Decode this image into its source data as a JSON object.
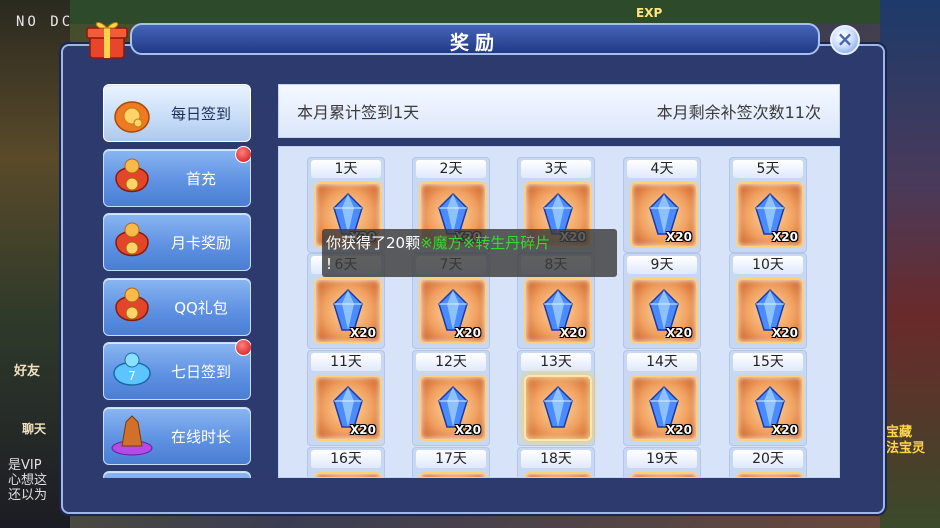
{
  "hud": {
    "top_left_text": "NO DC",
    "exp_label": "EXP",
    "side_friend": "好友",
    "side_chat": "聊天",
    "chat_lines": [
      "是VIP",
      "心想这",
      "还以为"
    ],
    "right_text": [
      "宝藏",
      "法宝灵"
    ]
  },
  "dialog": {
    "title": "奖励",
    "close_icon": "close-icon"
  },
  "sidebar": {
    "items": [
      {
        "label": "每日签到",
        "icon": "coin-bag-icon",
        "active": true,
        "badge": false
      },
      {
        "label": "首充",
        "icon": "lucky-bag-icon",
        "active": false,
        "badge": true
      },
      {
        "label": "月卡奖励",
        "icon": "lucky-bag-icon",
        "active": false,
        "badge": false
      },
      {
        "label": "QQ礼包",
        "icon": "lucky-bag-icon",
        "active": false,
        "badge": false
      },
      {
        "label": "七日签到",
        "icon": "blue-bag-icon",
        "active": false,
        "badge": true
      },
      {
        "label": "在线时长",
        "icon": "crystal-icon",
        "active": false,
        "badge": false
      }
    ]
  },
  "signin": {
    "total_text": "本月累计签到1天",
    "remaining_text": "本月剩余补签次数11次"
  },
  "rewards": [
    {
      "day": "1天",
      "qty": "X20"
    },
    {
      "day": "2天",
      "qty": "X20"
    },
    {
      "day": "3天",
      "qty": "X20"
    },
    {
      "day": "4天",
      "qty": "X20"
    },
    {
      "day": "5天",
      "qty": "X20"
    },
    {
      "day": "6天",
      "qty": "X20"
    },
    {
      "day": "7天",
      "qty": "X20"
    },
    {
      "day": "8天",
      "qty": "X20"
    },
    {
      "day": "9天",
      "qty": "X20"
    },
    {
      "day": "10天",
      "qty": "X20"
    },
    {
      "day": "11天",
      "qty": "X20"
    },
    {
      "day": "12天",
      "qty": "X20"
    },
    {
      "day": "13天",
      "qty": "",
      "highlight": true
    },
    {
      "day": "14天",
      "qty": "X20"
    },
    {
      "day": "15天",
      "qty": "X20"
    },
    {
      "day": "16天",
      "qty": ""
    },
    {
      "day": "17天",
      "qty": ""
    },
    {
      "day": "18天",
      "qty": ""
    },
    {
      "day": "19天",
      "qty": ""
    },
    {
      "day": "20天",
      "qty": ""
    }
  ],
  "toast": {
    "prefix": "你获得了20颗",
    "item_name": "※魔方※转生丹碎片",
    "suffix": "!"
  },
  "colors": {
    "toast_item": "#35d835",
    "panel_bg": "#2c3a6e",
    "badge": "#d01010"
  }
}
